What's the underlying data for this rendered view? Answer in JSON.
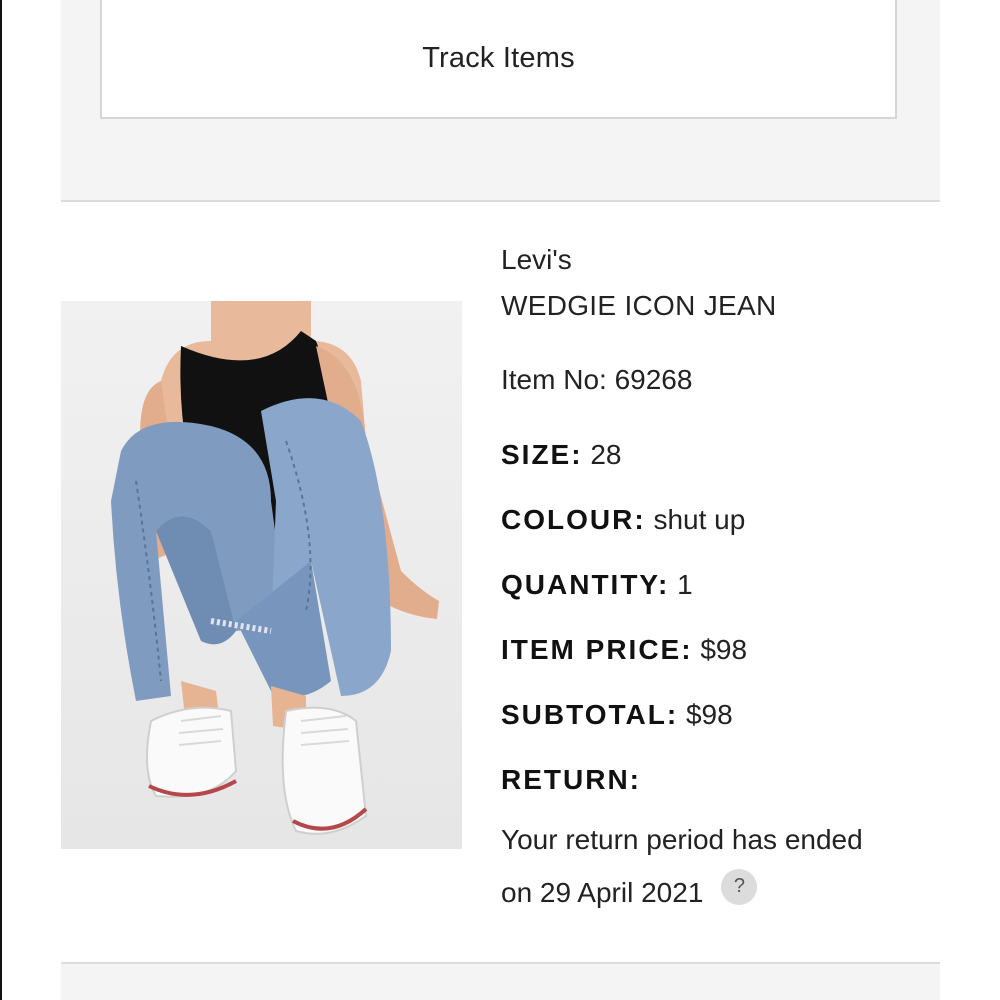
{
  "track": {
    "label": "Track Items"
  },
  "product": {
    "brand": "Levi's",
    "name": "WEDGIE ICON JEAN",
    "item_no": "Item No: 69268",
    "size_label": "SIZE:",
    "size_value": "28",
    "colour_label": "COLOUR:",
    "colour_value": "shut up",
    "quantity_label": "QUANTITY:",
    "quantity_value": "1",
    "price_label": "ITEM PRICE:",
    "price_value": "$98",
    "subtotal_label": "SUBTOTAL:",
    "subtotal_value": "$98",
    "return_label": "RETURN:",
    "return_line1": "Your return period has ended",
    "return_line2": "on 29 April 2021",
    "help_glyph": "?"
  },
  "icons": {
    "help": "help-icon"
  },
  "colors": {
    "panel_bg": "#f4f4f4",
    "border": "#d6d6d6",
    "help_bg": "#dcdcdc"
  }
}
